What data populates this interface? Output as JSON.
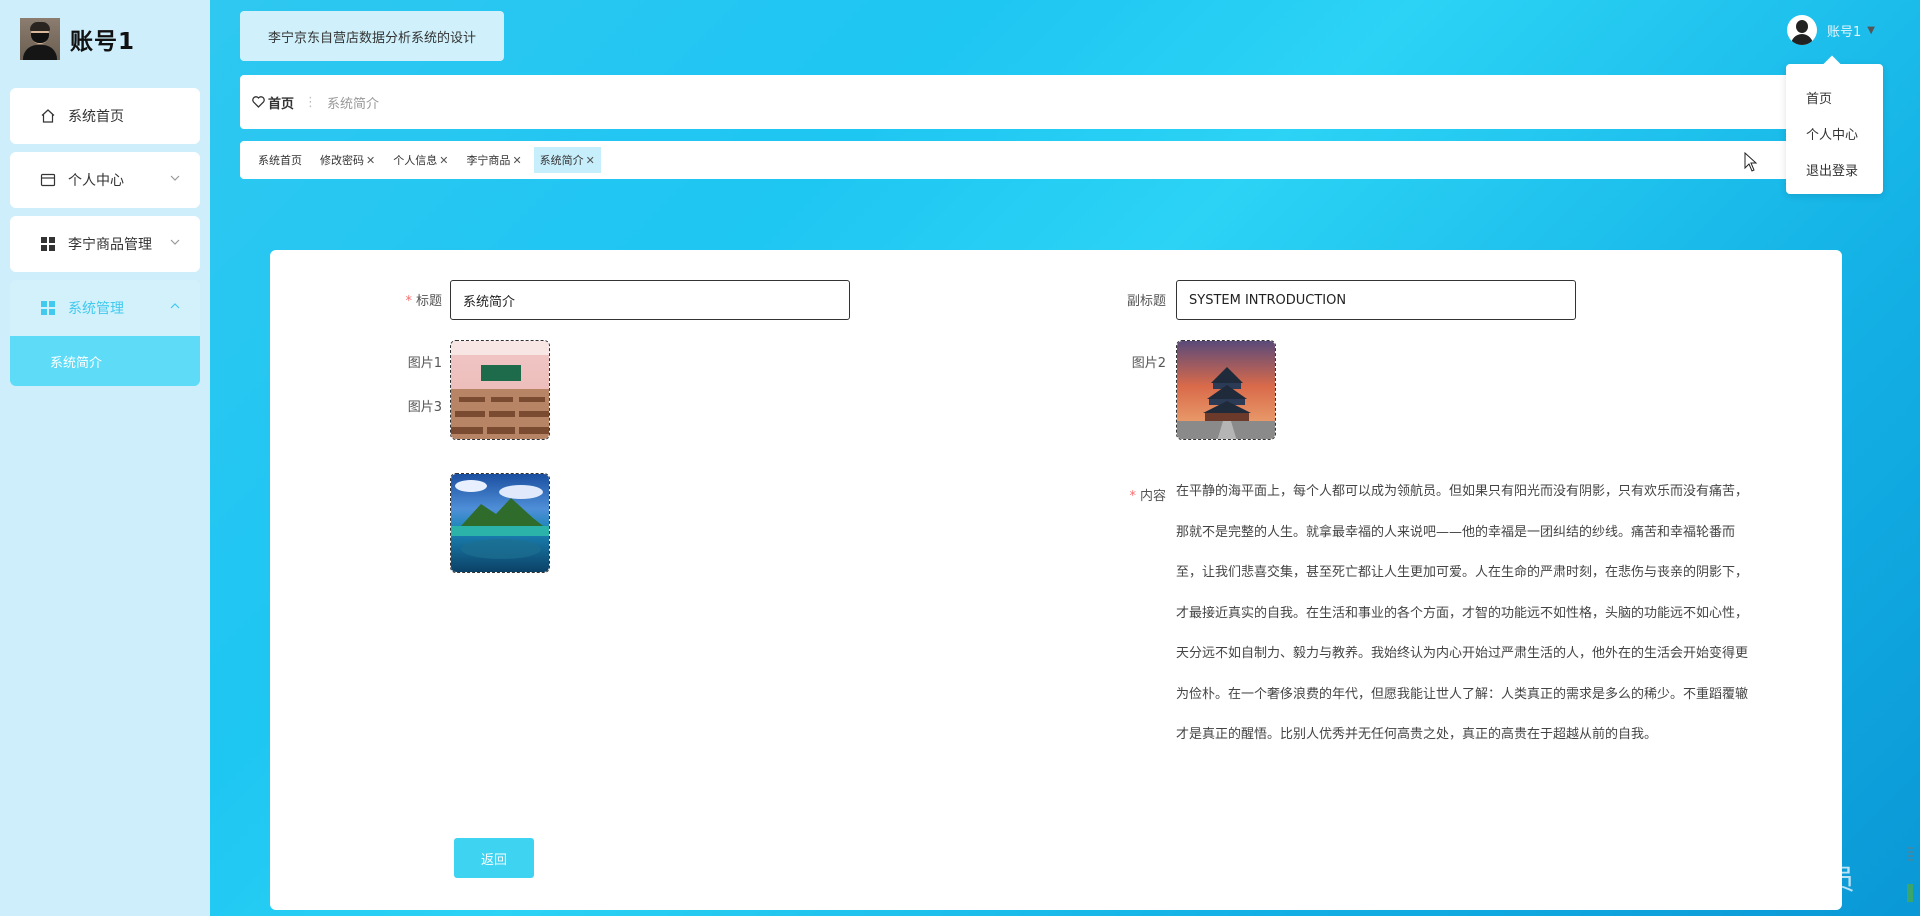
{
  "brand": {
    "name": "账号1"
  },
  "sidebar": {
    "items": [
      {
        "label": "系统首页",
        "icon": "home-icon"
      },
      {
        "label": "个人中心",
        "icon": "card-icon"
      },
      {
        "label": "李宁商品管理",
        "icon": "grid-icon"
      },
      {
        "label": "系统管理",
        "icon": "grid-icon"
      }
    ],
    "submenu": [
      {
        "label": "系统简介"
      }
    ]
  },
  "header": {
    "system_title": "李宁京东自营店数据分析系统的设计",
    "breadcrumb": {
      "home": "首页",
      "separator": "⋮",
      "current": "系统简介"
    },
    "user": {
      "name": "账号1"
    }
  },
  "user_menu": {
    "items": [
      "首页",
      "个人中心",
      "退出登录"
    ]
  },
  "tabs": [
    {
      "label": "系统首页",
      "closable": false
    },
    {
      "label": "修改密码",
      "closable": true
    },
    {
      "label": "个人信息",
      "closable": true
    },
    {
      "label": "李宁商品",
      "closable": true
    },
    {
      "label": "系统简介",
      "closable": true,
      "active": true
    }
  ],
  "form": {
    "title_label": "标题",
    "title_value": "系统简介",
    "subtitle_label": "副标题",
    "subtitle_value": "SYSTEM INTRODUCTION",
    "picture1_label": "图片1",
    "picture2_label": "图片2",
    "picture3_label": "图片3",
    "content_label": "内容",
    "required_mark": "*",
    "content": "在平静的海平面上，每个人都可以成为领航员。但如果只有阳光而没有阴影，只有欢乐而没有痛苦，那就不是完整的人生。就拿最幸福的人来说吧——他的幸福是一团纠结的纱线。痛苦和幸福轮番而至，让我们悲喜交集，甚至死亡都让人生更加可爱。人在生命的严肃时刻，在悲伤与丧亲的阴影下，才最接近真实的自我。在生活和事业的各个方面，才智的功能远不如性格，头脑的功能远不如心性，天分远不如自制力、毅力与教养。我始终认为内心开始过严肃生活的人，他外在的生活会开始变得更为俭朴。在一个奢侈浪费的年代，但愿我能让世人了解：人类真正的需求是多么的稀少。不重蹈覆辙才是真正的醒悟。比别人优秀并无任何高贵之处，真正的高贵在于超越从前的自我。",
    "back_button": "返回"
  },
  "watermark": "CSDN @毕业程序员",
  "colors": {
    "accent": "#3dd3f1",
    "active_submenu": "#5ddbf7",
    "required": "#f56c6c"
  }
}
